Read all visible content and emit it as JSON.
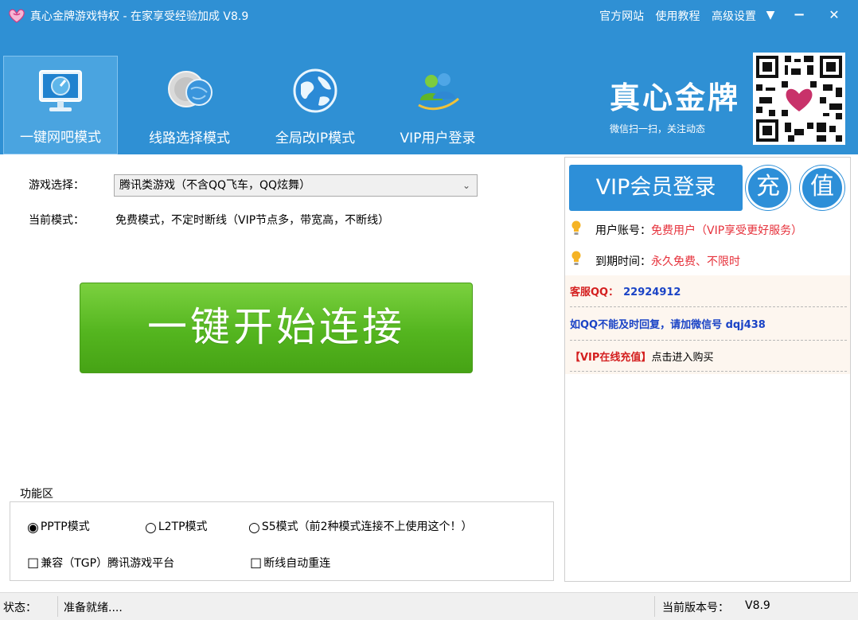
{
  "titlebar": {
    "title": "真心金牌游戏特权 - 在家享受经验加成 V8.9",
    "links": [
      "官方网站",
      "使用教程",
      "高级设置"
    ],
    "menu_glyph": "▼",
    "minimize_glyph": "−",
    "close_glyph": "✕"
  },
  "toolbar": {
    "tools": [
      {
        "label": "一键网吧模式",
        "icon": "monitor-icon"
      },
      {
        "label": "线路选择模式",
        "icon": "network-icon"
      },
      {
        "label": "全局改IP模式",
        "icon": "globe-icon"
      },
      {
        "label": "VIP用户登录",
        "icon": "users-icon"
      }
    ],
    "active_index": 0
  },
  "brand": {
    "title": "真心金牌",
    "subtitle": "微信扫一扫，关注动态"
  },
  "main": {
    "game_label": "游戏选择：",
    "game_value": "腾讯类游戏（不含QQ飞车，QQ炫舞）",
    "mode_label": "当前模式：",
    "mode_value": "免费模式，不定时断线（VIP节点多，带宽高，不断线）",
    "connect_label": "一键开始连接"
  },
  "functions": {
    "legend": "功能区",
    "radios": [
      {
        "label": "PPTP模式",
        "checked": true
      },
      {
        "label": "L2TP模式",
        "checked": false
      },
      {
        "label": "S5模式（前2种模式连接不上使用这个！）",
        "checked": false
      }
    ],
    "checkboxes": [
      {
        "label": "兼容（TGP）腾讯游戏平台",
        "checked": false
      },
      {
        "label": "断线自动重连",
        "checked": false
      }
    ]
  },
  "vip": {
    "login_label": "VIP会员登录",
    "recharge_1": "充",
    "recharge_2": "值",
    "account_label": "用户账号：",
    "account_value": "免费用户（VIP享受更好服务）",
    "expire_label": "到期时间：",
    "expire_value": "永久免费、不限时"
  },
  "notice": {
    "qq_label": "客服QQ：",
    "qq_value": "22924912",
    "wechat_text": "如QQ不能及时回复，请加微信号 dqj438",
    "vip_buy_tag": "【VIP在线充值】",
    "vip_buy_text": "点击进入购买"
  },
  "status": {
    "label": "状态：",
    "value": "准备就绪....",
    "version_label": "当前版本号：",
    "version_value": "V8.9"
  }
}
